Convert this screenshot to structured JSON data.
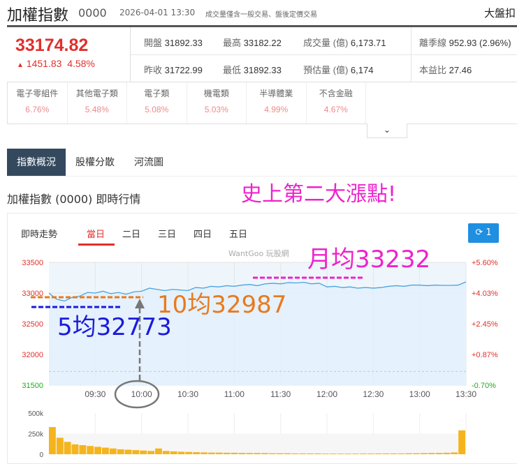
{
  "header": {
    "title": "加權指數",
    "code": "0000",
    "datetime": "2026-04-01 13:30",
    "note": "成交量僅含一般交易、盤後定價交易",
    "right_link": "大盤扣"
  },
  "quote": {
    "price": "33174.82",
    "change": "1451.83",
    "change_pct": "4.58%",
    "up_arrow": "▲"
  },
  "stats": {
    "open": {
      "label": "開盤",
      "value": "31892.33"
    },
    "high": {
      "label": "最高",
      "value": "33182.22"
    },
    "volume": {
      "label": "成交量 (億)",
      "value": "6,173.71"
    },
    "season_line": {
      "label": "離季線",
      "value": "952.93 (2.96%)"
    },
    "prev_close": {
      "label": "昨收",
      "value": "31722.99"
    },
    "low": {
      "label": "最低",
      "value": "31892.33"
    },
    "est_volume": {
      "label": "預估量 (億)",
      "value": "6,174"
    },
    "pe": {
      "label": "本益比",
      "value": "27.46"
    }
  },
  "sectors": [
    {
      "name": "電子零組件",
      "pct": "6.76%"
    },
    {
      "name": "其他電子類",
      "pct": "5.48%"
    },
    {
      "name": "電子類",
      "pct": "5.08%"
    },
    {
      "name": "機電類",
      "pct": "5.03%"
    },
    {
      "name": "半導體業",
      "pct": "4.99%"
    },
    {
      "name": "不含金融",
      "pct": "4.67%"
    }
  ],
  "expand_icon": "⌄",
  "tabs": [
    "指數概況",
    "股權分散",
    "河流圖"
  ],
  "section_title": "加權指數 (0000) 即時行情",
  "chart_panel": {
    "label": "即時走勢",
    "ranges": [
      "當日",
      "二日",
      "三日",
      "四日",
      "五日"
    ],
    "active_range": "當日",
    "refresh_icon": "⟳",
    "refresh_count": "1",
    "watermark": "WantGoo 玩股網"
  },
  "annotations": {
    "headline": "史上第二大漲點!",
    "month_avg": "月均33232",
    "ten_avg": "10均32987",
    "five_avg": "5均32773"
  },
  "colors": {
    "up": "#e0302b",
    "down": "#22aa22",
    "line": "#4aa3e0",
    "volume": "#f5b41e",
    "headline": "#ee22cc",
    "month": "#ee22cc",
    "ten": "#e87a1e",
    "five": "#1a1add"
  },
  "chart_data": {
    "type": "line",
    "title": "即時走勢",
    "y_left_ticks": [
      "33500",
      "33000",
      "32500",
      "32000",
      "31500"
    ],
    "y_right_ticks": [
      "+5.60%",
      "+4.03%",
      "+2.45%",
      "+0.87%",
      "-0.70%"
    ],
    "ylim": [
      31500,
      33500
    ],
    "prev_close": 31722.99,
    "x_ticks": [
      "09:30",
      "10:00",
      "10:30",
      "11:00",
      "11:30",
      "12:00",
      "12:30",
      "13:00",
      "13:30"
    ],
    "x_minutes_range": [
      0,
      270
    ],
    "price_interval_min": 5,
    "price": [
      33000,
      32900,
      32870,
      32930,
      32950,
      33010,
      33000,
      33030,
      32990,
      33010,
      32980,
      33020,
      33030,
      33080,
      33060,
      33040,
      33060,
      33050,
      33040,
      33090,
      33080,
      33110,
      33100,
      33120,
      33110,
      33130,
      33140,
      33120,
      33150,
      33160,
      33150,
      33170,
      33165,
      33175,
      33150,
      33160,
      33100,
      33110,
      33090,
      33100,
      33080,
      33090,
      33080,
      33090,
      33110,
      33120,
      33110,
      33130,
      33130,
      33120,
      33130,
      33125,
      33125,
      33130,
      33182
    ],
    "volume_ticks": [
      "500k",
      "250k",
      "0"
    ],
    "volume_max_k": 500,
    "volume_k": [
      330,
      200,
      150,
      120,
      110,
      100,
      90,
      80,
      70,
      60,
      55,
      50,
      45,
      40,
      70,
      40,
      35,
      30,
      28,
      25,
      22,
      20,
      20,
      18,
      18,
      16,
      15,
      15,
      14,
      12,
      12,
      12,
      10,
      10,
      10,
      10,
      8,
      8,
      8,
      8,
      8,
      9,
      9,
      10,
      10,
      10,
      10,
      12,
      12,
      14,
      15,
      16,
      18,
      22,
      290
    ]
  }
}
